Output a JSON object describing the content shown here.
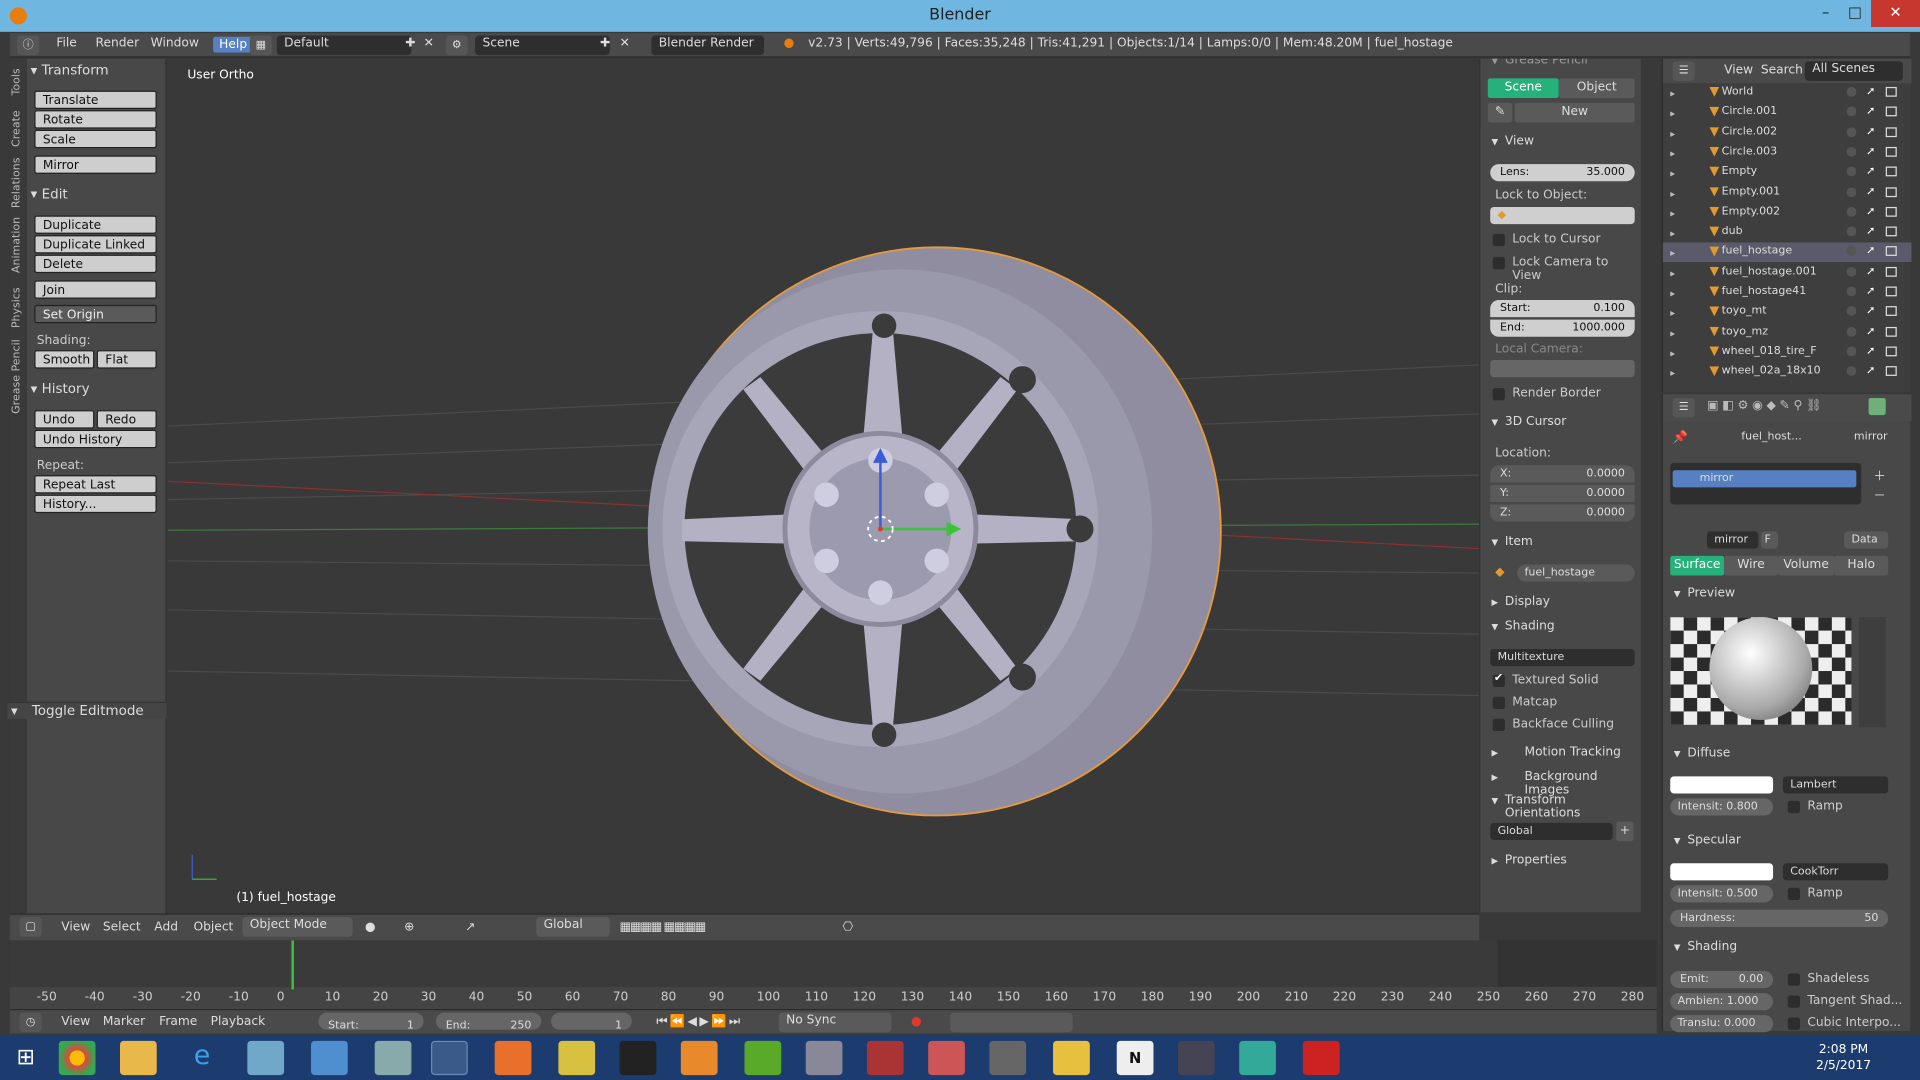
{
  "window": {
    "title": "Blender",
    "minimize": "–",
    "maximize": "□",
    "close": "✕"
  },
  "infobar": {
    "menus": [
      "File",
      "Render",
      "Window",
      "Help"
    ],
    "layout": "Default",
    "scene": "Scene",
    "engine": "Blender Render",
    "stats": "v2.73 | Verts:49,796 | Faces:35,248 | Tris:41,291 | Objects:1/14 | Lamps:0/0 | Mem:48.20M | fuel_hostage"
  },
  "tools_tabs": [
    "Tools",
    "Create",
    "Relations",
    "Animation",
    "Physics",
    "Grease Pencil"
  ],
  "toolshelf": {
    "transform_title": "Transform",
    "translate": "Translate",
    "rotate": "Rotate",
    "scale": "Scale",
    "mirror": "Mirror",
    "edit_title": "Edit",
    "duplicate": "Duplicate",
    "duplicate_linked": "Duplicate Linked",
    "delete": "Delete",
    "join": "Join",
    "set_origin": "Set Origin",
    "shading_label": "Shading:",
    "smooth": "Smooth",
    "flat": "Flat",
    "history_title": "History",
    "undo": "Undo",
    "redo": "Redo",
    "undo_history": "Undo History",
    "repeat_label": "Repeat:",
    "repeat_last": "Repeat Last",
    "history_btn": "History...",
    "toggle_editmode": "Toggle Editmode"
  },
  "viewport": {
    "view_name": "User Ortho",
    "active_object": "(1) fuel_hostage"
  },
  "vp_header": {
    "view": "View",
    "select": "Select",
    "add": "Add",
    "object": "Object",
    "mode": "Object Mode",
    "orientation": "Global"
  },
  "npanel": {
    "grease_pencil": "Grease Pencil",
    "scene_tab": "Scene",
    "object_tab": "Object",
    "new_btn": "New",
    "view_title": "View",
    "lens_label": "Lens:",
    "lens_value": "35.000",
    "lock_to_object": "Lock to Object:",
    "lock_to_cursor": "Lock to Cursor",
    "lock_camera": "Lock Camera to View",
    "clip_label": "Clip:",
    "clip_start_label": "Start:",
    "clip_start": "0.100",
    "clip_end_label": "End:",
    "clip_end": "1000.000",
    "local_camera": "Local Camera:",
    "render_border": "Render Border",
    "cursor_title": "3D Cursor",
    "location_label": "Location:",
    "x_label": "X:",
    "x": "0.0000",
    "y_label": "Y:",
    "y": "0.0000",
    "z_label": "Z:",
    "z": "0.0000",
    "item_title": "Item",
    "item_name": "fuel_hostage",
    "display_title": "Display",
    "shading_title": "Shading",
    "shading_mode": "Multitexture",
    "textured_solid": "Textured Solid",
    "matcap": "Matcap",
    "backface_culling": "Backface Culling",
    "motion_tracking": "Motion Tracking",
    "background_images": "Background Images",
    "transform_orientations": "Transform Orientations",
    "orientation_value": "Global",
    "properties": "Properties"
  },
  "outliner": {
    "view": "View",
    "search": "Search",
    "filter": "All Scenes",
    "rows": [
      {
        "name": "World"
      },
      {
        "name": "Circle.001"
      },
      {
        "name": "Circle.002"
      },
      {
        "name": "Circle.003"
      },
      {
        "name": "Empty"
      },
      {
        "name": "Empty.001"
      },
      {
        "name": "Empty.002"
      },
      {
        "name": "dub"
      },
      {
        "name": "fuel_hostage"
      },
      {
        "name": "fuel_hostage.001"
      },
      {
        "name": "fuel_hostage41"
      },
      {
        "name": "toyo_mt"
      },
      {
        "name": "toyo_mz"
      },
      {
        "name": "wheel_018_tire_F"
      },
      {
        "name": "wheel_02a_18x10"
      }
    ]
  },
  "props": {
    "breadcrumb_obj": "fuel_host...",
    "breadcrumb_mat": "mirror",
    "slot": "mirror",
    "mat_name": "mirror",
    "mat_f": "F",
    "data": "Data",
    "tabs": [
      "Surface",
      "Wire",
      "Volume",
      "Halo"
    ],
    "preview": "Preview",
    "diffuse": "Diffuse",
    "diffuse_shader": "Lambert",
    "diff_int": "Intensit: 0.800",
    "ramp": "Ramp",
    "specular": "Specular",
    "spec_shader": "CookTorr",
    "spec_int": "Intensit: 0.500",
    "hardness_label": "Hardness:",
    "hardness": "50",
    "shading": "Shading",
    "emit": "Emit:",
    "emit_v": "0.00",
    "shadeless": "Shadeless",
    "ambient": "Ambien: 1.000",
    "tangent": "Tangent Shad...",
    "translu": "Translu: 0.000",
    "cubic": "Cubic Interpo..."
  },
  "timeline": {
    "ticks": [
      "-50",
      "-40",
      "-30",
      "-20",
      "-10",
      "0",
      "10",
      "20",
      "30",
      "40",
      "50",
      "60",
      "70",
      "80",
      "90",
      "100",
      "110",
      "120",
      "130",
      "140",
      "150",
      "160",
      "170",
      "180",
      "190",
      "200",
      "210",
      "220",
      "230",
      "240",
      "250",
      "260",
      "270",
      "280"
    ],
    "view": "View",
    "marker": "Marker",
    "frame": "Frame",
    "playback": "Playback",
    "start_label": "Start:",
    "start": "1",
    "end_label": "End:",
    "end": "250",
    "current": "1",
    "sync": "No Sync"
  },
  "taskbar": {
    "time": "2:08 PM",
    "date": "2/5/2017"
  }
}
